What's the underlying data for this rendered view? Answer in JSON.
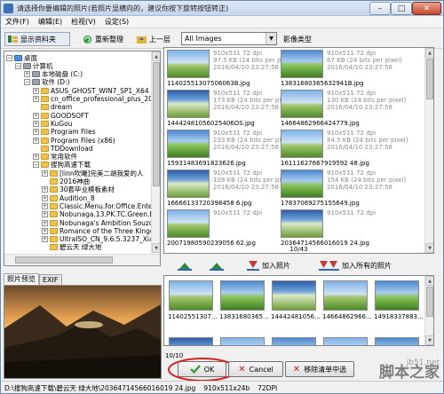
{
  "window": {
    "title": "请选择你要编辑的照片(若照片显横向的，建议你按下旋转按钮转正)",
    "buttons": {
      "minimize": "–",
      "maximize": "□",
      "close": "✕"
    }
  },
  "menu": [
    "文件(F)",
    "编辑(E)",
    "检视(V)",
    "设定(S)"
  ],
  "toolbar": {
    "show_tree": "显示资料夹",
    "refresh": "重新整理",
    "up": "上一层",
    "filter_value": "All Images",
    "type_label": "影像类型"
  },
  "tree": [
    {
      "label": "桌面",
      "level": 0,
      "expand": "−",
      "icon": "blue"
    },
    {
      "label": "计算机",
      "level": 1,
      "expand": "−",
      "icon": "gray"
    },
    {
      "label": "本地磁盘 (C:)",
      "level": 2,
      "expand": "+",
      "icon": "gray"
    },
    {
      "label": "软件 (D:)",
      "level": 2,
      "expand": "−",
      "icon": "gray"
    },
    {
      "label": "ASUS_GHOST_WIN7_SP1_X64",
      "level": 3,
      "expand": "+",
      "icon": "yellow"
    },
    {
      "label": "cn_office_professional_plus_2013",
      "level": 3,
      "expand": "+",
      "icon": "yellow"
    },
    {
      "label": "dream",
      "level": 3,
      "expand": "",
      "icon": "yellow"
    },
    {
      "label": "GOODSOFT",
      "level": 3,
      "expand": "+",
      "icon": "yellow"
    },
    {
      "label": "KuGou",
      "level": 3,
      "expand": "+",
      "icon": "yellow"
    },
    {
      "label": "Program Files",
      "level": 3,
      "expand": "+",
      "icon": "yellow"
    },
    {
      "label": "Program Files (x86)",
      "level": 3,
      "expand": "+",
      "icon": "yellow"
    },
    {
      "label": "TDDownload",
      "level": 3,
      "expand": "",
      "icon": "yellow"
    },
    {
      "label": "常用软件",
      "level": 3,
      "expand": "+",
      "icon": "yellow"
    },
    {
      "label": "搜狗高速下载",
      "level": 3,
      "expand": "−",
      "icon": "yellow"
    },
    {
      "label": "[linn吹曦]完美二胡我爱的人",
      "level": 4,
      "expand": "+",
      "icon": "yellow"
    },
    {
      "label": "2016神曲",
      "level": 4,
      "expand": "",
      "icon": "yellow"
    },
    {
      "label": "30套毕业模板素材",
      "level": 4,
      "expand": "+",
      "icon": "yellow"
    },
    {
      "label": "Audition_8",
      "level": 4,
      "expand": "+",
      "icon": "yellow"
    },
    {
      "label": "Classic.Menu.for.Office.Enterp",
      "level": 4,
      "expand": "+",
      "icon": "yellow"
    },
    {
      "label": "Nobunaga.13.PK.TC.Green.E",
      "level": 4,
      "expand": "+",
      "icon": "yellow"
    },
    {
      "label": "Nobunaga's Ambition Souzou",
      "level": 4,
      "expand": "+",
      "icon": "yellow"
    },
    {
      "label": "Romance of the Three Kingdc",
      "level": 4,
      "expand": "+",
      "icon": "yellow"
    },
    {
      "label": "UltraISO_CN_9.6.5.3237_Xia",
      "level": 4,
      "expand": "+",
      "icon": "yellow"
    },
    {
      "label": "碧云天 绿大地",
      "level": 4,
      "expand": "",
      "icon": "yellow"
    }
  ],
  "grid": [
    {
      "info": "910x511 72 dpi",
      "bits": "97.5 KB (24 bits per pixel)",
      "date": "2016/04/10 23:27:58",
      "name": "11402551307506063B.jpg",
      "style": "sky"
    },
    {
      "info": "910x511 72 dpi",
      "bits": "67 KB (24 bits per pixel)",
      "date": "2016/04/10 23:27:58",
      "name": "13831680365632941B.jpg",
      "style": "sky2"
    },
    {
      "info": "910x511 72 dpi",
      "bits": "173 KB (24 bits per pixel)",
      "date": "2016/04/10 23:27:58",
      "name": "14442481056025406OS.jpg",
      "style": "sky3"
    },
    {
      "info": "910x511 72 dpi",
      "bits": "130 KB (24 bits per pixel)",
      "date": "2016/04/10 23:27:58",
      "name": "14664862966424779.jpg",
      "style": "sky"
    },
    {
      "info": "910x511 72 dpi",
      "bits": "233 KB (24 bits per pixel)",
      "date": "2016/04/10 23:27:58",
      "name": "15931483691823626.jpg",
      "style": "sky2"
    },
    {
      "info": "910x511 72 dpi",
      "bits": "84.5 KB (24 bits per pixel)",
      "date": "2016/04/10 23:27:58",
      "name": "16111627667919592 48.jpg",
      "style": "sky"
    },
    {
      "info": "910x511 72 dpi",
      "bits": "109 KB (24 bits per pixel)",
      "date": "2016/04/10 23:27:58",
      "name": "16666133720398458 6.jpg",
      "style": "sky3"
    },
    {
      "info": "910x511 72 dpi",
      "bits": "154 KB (24 bits per pixel)",
      "date": "2016/04/10 23:27:58",
      "name": "17837069275155649.jpg",
      "style": "sky2"
    },
    {
      "info": "910x511 72 dpi",
      "bits": "",
      "date": "",
      "name": "20071980590239056 62.jpg",
      "style": "sky"
    },
    {
      "info": "910x511 72 dpi",
      "bits": "",
      "date": "",
      "name": "20364714566016019 24.jpg",
      "style": "sky3"
    }
  ],
  "grid_counter": "10/43",
  "actions": {
    "add": "加入照片",
    "add_all": "加入所有的照片"
  },
  "strip": [
    {
      "label": "11402551307...",
      "style": "sky"
    },
    {
      "label": "13831680365...",
      "style": "sky2"
    },
    {
      "label": "14442481056...",
      "style": "sky3"
    },
    {
      "label": "14664862966...",
      "style": "sky"
    },
    {
      "label": "14918337883...",
      "style": "sky2"
    }
  ],
  "strip_counter": "10/10",
  "buttons": {
    "ok": "OK",
    "cancel": "Cancel",
    "remove": "移除清单中选"
  },
  "preview_tabs": [
    "照片预览",
    "EXIF"
  ],
  "status": {
    "path": "D:\\搜狗高速下载\\碧云天 绿大地\\20364714566016019 24.jpg",
    "size": "910x511x24b",
    "dpi": "72DPI"
  },
  "watermark": {
    "line1": "jb51.net",
    "line2": "脚本之家"
  }
}
